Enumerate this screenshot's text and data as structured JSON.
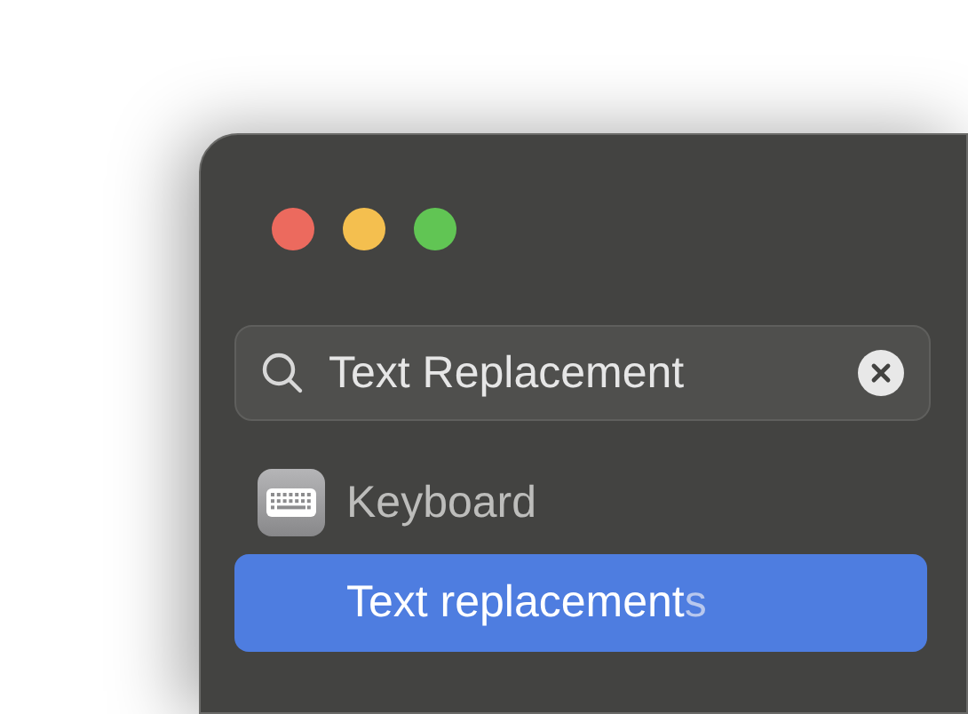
{
  "search": {
    "value": "Text Replacement"
  },
  "results": [
    {
      "kind": "category",
      "label": "Keyboard",
      "children": [
        {
          "label": "Text replacement",
          "unmatched": "s",
          "selected": true
        }
      ]
    }
  ]
}
